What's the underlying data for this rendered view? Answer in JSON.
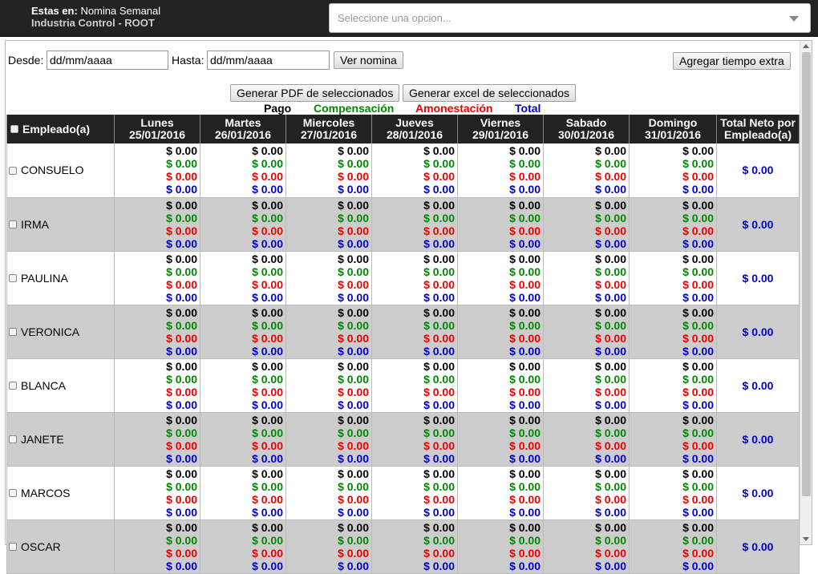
{
  "header": {
    "location_label": "Estas en:",
    "location_value": "Nomina Semanal",
    "company": "Industria Control - ROOT",
    "select_placeholder": "Seleccione una opcion..."
  },
  "filters": {
    "desde_label": "Desde:",
    "desde_value": "dd/mm/aaaa",
    "hasta_label": "Hasta:",
    "hasta_value": "dd/mm/aaaa",
    "ver_nomina": "Ver nomina",
    "agregar": "Agregar tiempo extra",
    "gen_pdf": "Generar PDF de seleccionados",
    "gen_excel": "Generar excel de seleccionados"
  },
  "legend": {
    "pago": "Pago",
    "compensacion": "Compensación",
    "amonestacion": "Amonestación",
    "total": "Total"
  },
  "colors": {
    "pago": "#000000",
    "compensacion": "#008800",
    "amonestacion": "#ee0000",
    "total": "#0000cc",
    "header_bg": "#222222",
    "row_alt_bg": "#cdcdcd"
  },
  "table": {
    "employee_header": "Empleado(a)",
    "net_header_1": "Total Neto por",
    "net_header_2": "Empleado(a)",
    "days": [
      {
        "name": "Lunes",
        "date": "25/01/2016"
      },
      {
        "name": "Martes",
        "date": "26/01/2016"
      },
      {
        "name": "Miercoles",
        "date": "27/01/2016"
      },
      {
        "name": "Jueves",
        "date": "28/01/2016"
      },
      {
        "name": "Viernes",
        "date": "29/01/2016"
      },
      {
        "name": "Sabado",
        "date": "30/01/2016"
      },
      {
        "name": "Domingo",
        "date": "31/01/2016"
      }
    ],
    "rows": [
      {
        "name": "CONSUELO",
        "days": [
          [
            "$ 0.00",
            "$ 0.00",
            "$ 0.00",
            "$ 0.00"
          ],
          [
            "$ 0.00",
            "$ 0.00",
            "$ 0.00",
            "$ 0.00"
          ],
          [
            "$ 0.00",
            "$ 0.00",
            "$ 0.00",
            "$ 0.00"
          ],
          [
            "$ 0.00",
            "$ 0.00",
            "$ 0.00",
            "$ 0.00"
          ],
          [
            "$ 0.00",
            "$ 0.00",
            "$ 0.00",
            "$ 0.00"
          ],
          [
            "$ 0.00",
            "$ 0.00",
            "$ 0.00",
            "$ 0.00"
          ],
          [
            "$ 0.00",
            "$ 0.00",
            "$ 0.00",
            "$ 0.00"
          ]
        ],
        "net": "$ 0.00"
      },
      {
        "name": "IRMA",
        "days": [
          [
            "$ 0.00",
            "$ 0.00",
            "$ 0.00",
            "$ 0.00"
          ],
          [
            "$ 0.00",
            "$ 0.00",
            "$ 0.00",
            "$ 0.00"
          ],
          [
            "$ 0.00",
            "$ 0.00",
            "$ 0.00",
            "$ 0.00"
          ],
          [
            "$ 0.00",
            "$ 0.00",
            "$ 0.00",
            "$ 0.00"
          ],
          [
            "$ 0.00",
            "$ 0.00",
            "$ 0.00",
            "$ 0.00"
          ],
          [
            "$ 0.00",
            "$ 0.00",
            "$ 0.00",
            "$ 0.00"
          ],
          [
            "$ 0.00",
            "$ 0.00",
            "$ 0.00",
            "$ 0.00"
          ]
        ],
        "net": "$ 0.00"
      },
      {
        "name": "PAULINA",
        "days": [
          [
            "$ 0.00",
            "$ 0.00",
            "$ 0.00",
            "$ 0.00"
          ],
          [
            "$ 0.00",
            "$ 0.00",
            "$ 0.00",
            "$ 0.00"
          ],
          [
            "$ 0.00",
            "$ 0.00",
            "$ 0.00",
            "$ 0.00"
          ],
          [
            "$ 0.00",
            "$ 0.00",
            "$ 0.00",
            "$ 0.00"
          ],
          [
            "$ 0.00",
            "$ 0.00",
            "$ 0.00",
            "$ 0.00"
          ],
          [
            "$ 0.00",
            "$ 0.00",
            "$ 0.00",
            "$ 0.00"
          ],
          [
            "$ 0.00",
            "$ 0.00",
            "$ 0.00",
            "$ 0.00"
          ]
        ],
        "net": "$ 0.00"
      },
      {
        "name": "VERONICA",
        "days": [
          [
            "$ 0.00",
            "$ 0.00",
            "$ 0.00",
            "$ 0.00"
          ],
          [
            "$ 0.00",
            "$ 0.00",
            "$ 0.00",
            "$ 0.00"
          ],
          [
            "$ 0.00",
            "$ 0.00",
            "$ 0.00",
            "$ 0.00"
          ],
          [
            "$ 0.00",
            "$ 0.00",
            "$ 0.00",
            "$ 0.00"
          ],
          [
            "$ 0.00",
            "$ 0.00",
            "$ 0.00",
            "$ 0.00"
          ],
          [
            "$ 0.00",
            "$ 0.00",
            "$ 0.00",
            "$ 0.00"
          ],
          [
            "$ 0.00",
            "$ 0.00",
            "$ 0.00",
            "$ 0.00"
          ]
        ],
        "net": "$ 0.00"
      },
      {
        "name": "BLANCA",
        "days": [
          [
            "$ 0.00",
            "$ 0.00",
            "$ 0.00",
            "$ 0.00"
          ],
          [
            "$ 0.00",
            "$ 0.00",
            "$ 0.00",
            "$ 0.00"
          ],
          [
            "$ 0.00",
            "$ 0.00",
            "$ 0.00",
            "$ 0.00"
          ],
          [
            "$ 0.00",
            "$ 0.00",
            "$ 0.00",
            "$ 0.00"
          ],
          [
            "$ 0.00",
            "$ 0.00",
            "$ 0.00",
            "$ 0.00"
          ],
          [
            "$ 0.00",
            "$ 0.00",
            "$ 0.00",
            "$ 0.00"
          ],
          [
            "$ 0.00",
            "$ 0.00",
            "$ 0.00",
            "$ 0.00"
          ]
        ],
        "net": "$ 0.00"
      },
      {
        "name": "JANETE",
        "days": [
          [
            "$ 0.00",
            "$ 0.00",
            "$ 0.00",
            "$ 0.00"
          ],
          [
            "$ 0.00",
            "$ 0.00",
            "$ 0.00",
            "$ 0.00"
          ],
          [
            "$ 0.00",
            "$ 0.00",
            "$ 0.00",
            "$ 0.00"
          ],
          [
            "$ 0.00",
            "$ 0.00",
            "$ 0.00",
            "$ 0.00"
          ],
          [
            "$ 0.00",
            "$ 0.00",
            "$ 0.00",
            "$ 0.00"
          ],
          [
            "$ 0.00",
            "$ 0.00",
            "$ 0.00",
            "$ 0.00"
          ],
          [
            "$ 0.00",
            "$ 0.00",
            "$ 0.00",
            "$ 0.00"
          ]
        ],
        "net": "$ 0.00"
      },
      {
        "name": "MARCOS",
        "days": [
          [
            "$ 0.00",
            "$ 0.00",
            "$ 0.00",
            "$ 0.00"
          ],
          [
            "$ 0.00",
            "$ 0.00",
            "$ 0.00",
            "$ 0.00"
          ],
          [
            "$ 0.00",
            "$ 0.00",
            "$ 0.00",
            "$ 0.00"
          ],
          [
            "$ 0.00",
            "$ 0.00",
            "$ 0.00",
            "$ 0.00"
          ],
          [
            "$ 0.00",
            "$ 0.00",
            "$ 0.00",
            "$ 0.00"
          ],
          [
            "$ 0.00",
            "$ 0.00",
            "$ 0.00",
            "$ 0.00"
          ],
          [
            "$ 0.00",
            "$ 0.00",
            "$ 0.00",
            "$ 0.00"
          ]
        ],
        "net": "$ 0.00"
      },
      {
        "name": "OSCAR",
        "days": [
          [
            "$ 0.00",
            "$ 0.00",
            "$ 0.00",
            "$ 0.00"
          ],
          [
            "$ 0.00",
            "$ 0.00",
            "$ 0.00",
            "$ 0.00"
          ],
          [
            "$ 0.00",
            "$ 0.00",
            "$ 0.00",
            "$ 0.00"
          ],
          [
            "$ 0.00",
            "$ 0.00",
            "$ 0.00",
            "$ 0.00"
          ],
          [
            "$ 0.00",
            "$ 0.00",
            "$ 0.00",
            "$ 0.00"
          ],
          [
            "$ 0.00",
            "$ 0.00",
            "$ 0.00",
            "$ 0.00"
          ],
          [
            "$ 0.00",
            "$ 0.00",
            "$ 0.00",
            "$ 0.00"
          ]
        ],
        "net": "$ 0.00"
      }
    ]
  }
}
